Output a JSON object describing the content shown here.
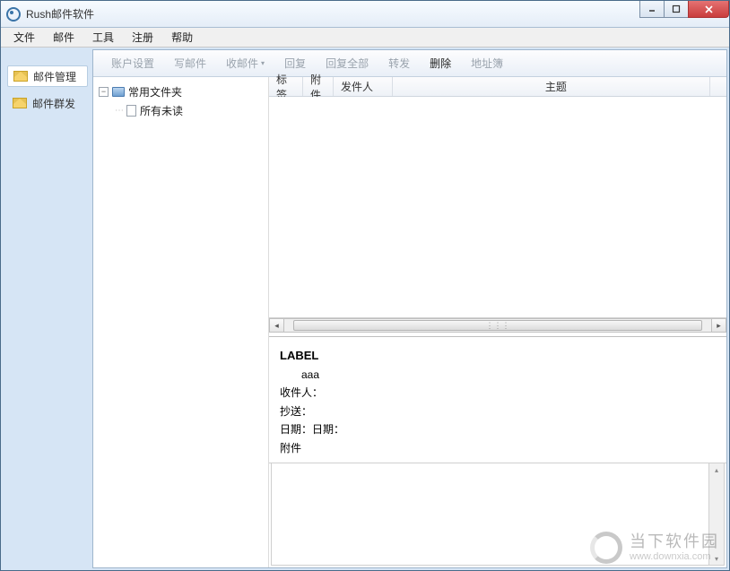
{
  "window": {
    "title": "Rush邮件软件"
  },
  "menubar": [
    "文件",
    "邮件",
    "工具",
    "注册",
    "帮助"
  ],
  "leftnav": {
    "items": [
      {
        "label": "邮件管理",
        "selected": true
      },
      {
        "label": "邮件群发",
        "selected": false
      }
    ]
  },
  "toolbar": {
    "account_settings": "账户设置",
    "compose": "写邮件",
    "receive": "收邮件",
    "reply": "回复",
    "reply_all": "回复全部",
    "forward": "转发",
    "delete": "删除",
    "address_book": "地址簿"
  },
  "tree": {
    "root": "常用文件夹",
    "children": [
      "所有未读"
    ]
  },
  "list_columns": {
    "tag": "标签",
    "attachment": "附件",
    "sender": "发件人",
    "subject": "主题"
  },
  "preview": {
    "label": "LABEL",
    "from": "aaa",
    "recipient_label": "收件人：",
    "cc_label": "抄送：",
    "date_label": "日期：日期：",
    "attachment_label": "附件"
  },
  "watermark": {
    "text1": "当下软件园",
    "text2": "www.downxia.com"
  }
}
